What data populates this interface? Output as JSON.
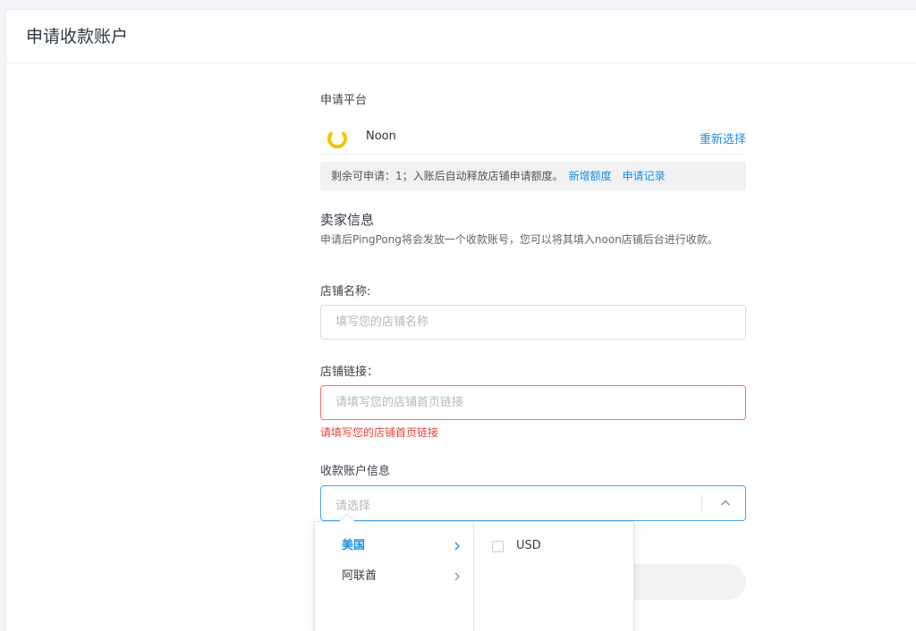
{
  "page": {
    "title": "申请收款账户"
  },
  "platform": {
    "section_label": "申请平台",
    "name": "Noon",
    "logo_color": "#f5c400",
    "reselect_label": "重新选择"
  },
  "quota": {
    "text": "剩余可申请：1；入账后自动释放店铺申请额度。",
    "add_label": "新增额度",
    "records_label": "申请记录"
  },
  "seller": {
    "title": "卖家信息",
    "description": "申请后PingPong将会发放一个收款账号，您可以将其填入noon店铺后台进行收款。"
  },
  "store_name": {
    "label": "店铺名称:",
    "placeholder": "填写您的店铺名称",
    "value": ""
  },
  "store_link": {
    "label": "店铺链接：",
    "placeholder": "请填写您的店铺首页链接",
    "value": "",
    "error": "请填写您的店铺首页链接"
  },
  "account_info": {
    "label": "收款账户信息",
    "placeholder": "请选择"
  },
  "cascader": {
    "regions": [
      {
        "label": "美国",
        "active": true
      },
      {
        "label": "阿联酋",
        "active": false
      }
    ],
    "options": [
      {
        "label": "USD",
        "checked": false
      }
    ]
  },
  "colors": {
    "accent": "#1c8fe0",
    "error": "#e8413e",
    "focus_border": "#45a6e8"
  }
}
